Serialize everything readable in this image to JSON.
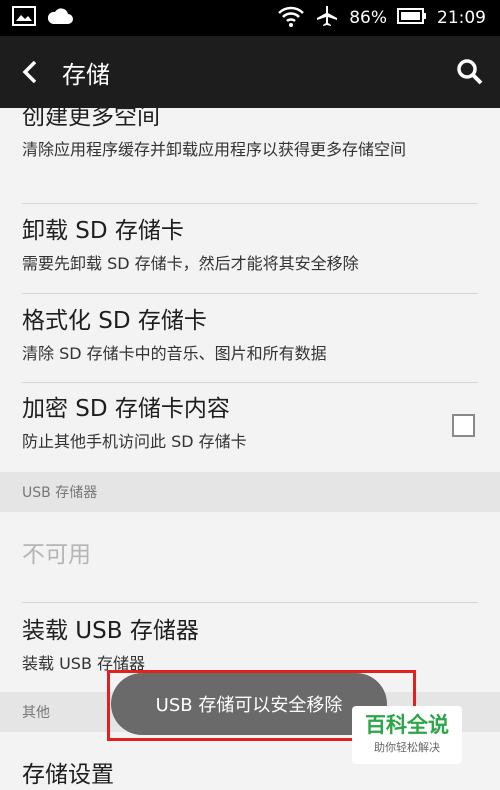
{
  "status_bar": {
    "battery_percent": "86%",
    "time": "21:09",
    "icons": [
      "image-icon",
      "cloud-icon",
      "wifi-icon",
      "airplane-icon",
      "battery-icon"
    ]
  },
  "app_bar": {
    "title": "存储"
  },
  "items": [
    {
      "title": "创建更多空间",
      "subtitle": "清除应用程序缓存并卸载应用程序以获得更多存储空间"
    },
    {
      "title": "卸载 SD 存储卡",
      "subtitle": "需要先卸载 SD 存储卡，然后才能将其安全移除"
    },
    {
      "title": "格式化 SD 存储卡",
      "subtitle": "清除 SD 存储卡中的音乐、图片和所有数据"
    },
    {
      "title": "加密 SD 存储卡内容",
      "subtitle": "防止其他手机访问此 SD 存储卡",
      "checked": false
    }
  ],
  "usb_section": {
    "header": "USB 存储器",
    "unavailable": "不可用",
    "mount_title": "装载 USB 存储器",
    "mount_subtitle": "装载 USB 存储器"
  },
  "other_section": {
    "header": "其他",
    "storage_settings": "存储设置"
  },
  "toast": "USB 存储可以安全移除",
  "watermark": {
    "main": "百科全说",
    "sub": "助你轻松解决"
  },
  "colors": {
    "app_bar": "#1d1d1d",
    "highlight": "#e1201f",
    "watermark_green": "#2ba648"
  }
}
